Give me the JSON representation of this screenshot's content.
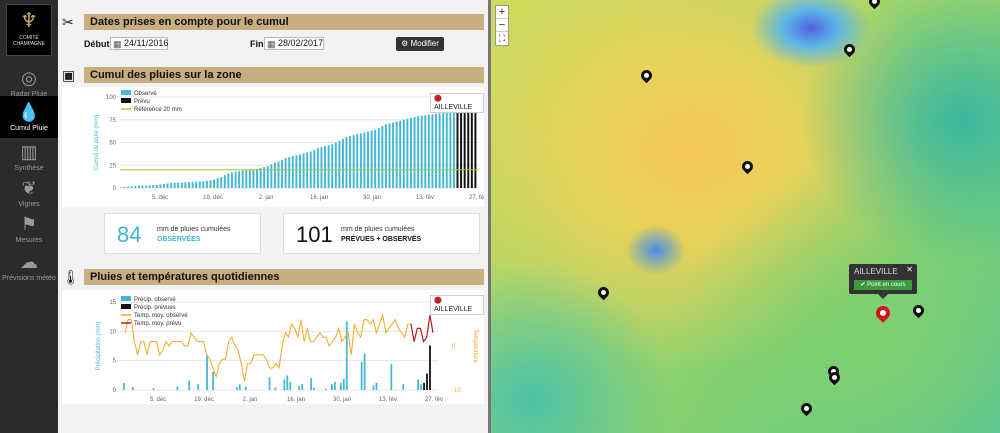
{
  "sidebar": {
    "logo_line1": "COMITÉ",
    "logo_line2": "CHAMPAGNE",
    "items": [
      {
        "label": "Radar Pluie",
        "icon": "radar-icon"
      },
      {
        "label": "Cumul Pluie",
        "icon": "raindrops-icon"
      },
      {
        "label": "Synthèse",
        "icon": "bar-chart-icon"
      },
      {
        "label": "Vignes",
        "icon": "vine-leaf-icon"
      },
      {
        "label": "Mesures",
        "icon": "weather-station-icon"
      },
      {
        "label": "Prévisions météo",
        "icon": "cloud-sun-icon"
      }
    ]
  },
  "dates_section": {
    "title": "Dates prises en compte pour le cumul",
    "start_label": "Début",
    "start_value": "24/11/2016",
    "end_label": "Fin",
    "end_value": "28/02/2017",
    "button_label": "Modifier"
  },
  "cumul_section": {
    "title": "Cumul des pluies sur la zone",
    "location": "AILLEVILLE",
    "stats": [
      {
        "value": "84",
        "line1": "mm de pluies cumulées",
        "line2": "OBSERVÉES",
        "color": "#3fb7d2"
      },
      {
        "value": "101",
        "line1": "mm de pluies cumulées",
        "line2": "PRÉVUES + OBSERVÉS",
        "color": "#111111"
      }
    ]
  },
  "daily_section": {
    "title": "Pluies et températures quotidiennes",
    "location": "AILLEVILLE"
  },
  "chart_data": [
    {
      "type": "bar",
      "ylabel": "Cumul de pluie (mm)",
      "ylim": [
        0,
        100
      ],
      "yticks": [
        "0",
        "25",
        "50",
        "75",
        "100"
      ],
      "xticks": [
        "5. déc",
        "19. déc",
        "2. jan",
        "16. jan",
        "30. jan",
        "13. fév",
        "27. fév"
      ],
      "legend": [
        "Observé",
        "Prévu",
        "Référence 20 mm"
      ],
      "colors": {
        "observed": "#45b8d6",
        "forecast": "#111111",
        "reference": "#9acd32"
      },
      "reference": 20,
      "observed_end": 84,
      "forecast_end": 101,
      "observed": [
        0.6,
        1.2,
        1.5,
        1.8,
        2.1,
        2.4,
        2.6,
        2.8,
        3,
        3.2,
        3.5,
        4,
        4.5,
        5,
        5.3,
        5.6,
        5.8,
        6,
        6.3,
        6.5,
        6.8,
        7,
        7.2,
        7.5,
        8,
        8.5,
        9.5,
        11,
        12,
        14,
        16,
        17,
        18,
        18.5,
        19,
        19.5,
        20,
        20.5,
        21,
        22,
        23,
        24,
        26,
        28,
        29,
        31,
        33,
        34,
        35,
        36,
        37,
        38,
        39,
        40,
        42,
        44,
        45,
        46,
        47,
        48,
        50,
        52,
        54,
        56,
        57,
        58,
        59,
        60,
        61,
        62,
        63,
        64,
        66,
        68,
        70,
        71,
        72,
        73,
        74,
        75,
        76,
        77,
        78,
        79,
        79.5,
        80,
        80.5,
        81,
        81.5,
        82,
        82.5,
        83,
        83.5,
        84
      ],
      "forecast": [
        87,
        90,
        92,
        95,
        98,
        101
      ]
    },
    {
      "type": "bar",
      "ylabel": "Précipitation (mm)",
      "y2label": "Température",
      "ylim": [
        0,
        15
      ],
      "y2lim": [
        -10,
        10
      ],
      "yticks": [
        "0",
        "5",
        "10",
        "15"
      ],
      "y2ticks": [
        "-10",
        "0",
        "10"
      ],
      "xticks": [
        "5. déc",
        "19. déc",
        "2. jan",
        "16. jan",
        "30. jan",
        "13. fév",
        "27. fév"
      ],
      "legend": [
        "Précip. observé",
        "Précip. prévues",
        "Temp. moy. observé",
        "Temp. moy. prévu"
      ],
      "colors": {
        "precip_obs": "#45b8d6",
        "precip_prev": "#111111",
        "temp_obs": "#f5a623",
        "temp_prev": "#b11a1a"
      },
      "precip_obs": [
        0,
        1.2,
        0,
        0,
        0.5,
        0,
        0,
        0,
        0,
        0,
        0,
        0.3,
        0,
        0,
        0,
        0,
        0,
        0,
        0,
        0.6,
        0,
        0,
        0,
        1.6,
        0,
        0,
        1,
        0,
        0,
        6,
        0,
        3.1,
        0,
        0,
        0,
        0,
        0,
        0,
        0,
        0.5,
        1,
        0,
        0.6,
        0,
        0,
        0,
        0,
        0,
        0,
        0,
        2.2,
        0,
        0.4,
        0,
        0,
        1.8,
        2.5,
        1.4,
        0,
        0,
        0.7,
        1,
        0,
        0,
        2,
        0.4,
        0,
        0,
        0,
        0.2,
        0,
        1,
        1.4,
        0,
        1.2,
        1.9,
        11.7,
        0,
        0,
        0,
        0,
        4.8,
        6.2,
        0,
        0,
        0.8,
        1.2,
        0,
        0,
        0,
        0,
        4.4,
        0,
        0,
        0,
        1,
        0,
        0,
        0,
        0,
        1.8,
        1
      ],
      "precip_prev": [
        1.2,
        2.8,
        7.6,
        0,
        0
      ],
      "temp_obs": [
        3,
        6,
        6,
        1,
        -2,
        1,
        1,
        -2,
        1,
        1,
        1,
        -2,
        -1,
        1,
        0,
        1,
        1,
        1,
        1,
        0,
        0,
        3,
        2,
        1,
        1,
        1,
        -2,
        -3,
        -5,
        -7,
        -4,
        -3,
        -3,
        1,
        2,
        0,
        -1,
        -4,
        -8,
        -4,
        -4,
        -2,
        -2,
        -2,
        -2,
        -3,
        -5,
        -5,
        -4,
        -5,
        0,
        3,
        2,
        5,
        4,
        2,
        6,
        1,
        4,
        1,
        1,
        2,
        3,
        2,
        2,
        0,
        1,
        2,
        4,
        1,
        2,
        3,
        -2,
        5,
        3,
        2,
        6,
        6,
        5,
        6,
        3,
        5,
        7,
        3,
        4,
        5,
        6,
        4,
        3,
        2,
        5,
        5
      ],
      "temp_prev": [
        1,
        4,
        4,
        1,
        2,
        7,
        3
      ]
    }
  ],
  "map": {
    "zoom_in": "+",
    "zoom_out": "−",
    "fullscreen": "⛶",
    "popup_title": "AILLEVILLE",
    "popup_close": "✕",
    "popup_badge": "Point en cours"
  }
}
